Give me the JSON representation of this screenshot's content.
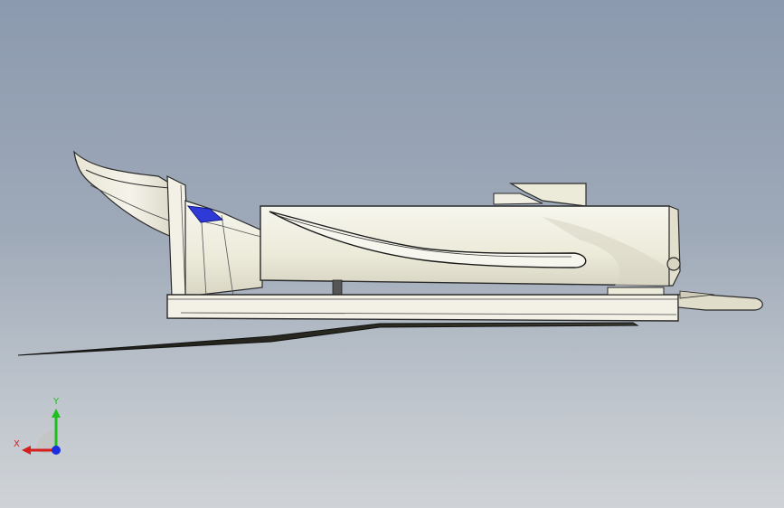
{
  "viewport": {
    "background_top": "#8c9aaf",
    "background_bottom": "#cfd3d7"
  },
  "model": {
    "body_color": "#f1efe6",
    "shadow_color": "#d4d1c3",
    "edge_color": "#2a2a2a",
    "accent_color": "#2f39d6"
  },
  "triad": {
    "x_label": "X",
    "y_label": "Y",
    "x_color": "#d62020",
    "y_color": "#1fbf1f",
    "z_color": "#1a2ee0"
  }
}
